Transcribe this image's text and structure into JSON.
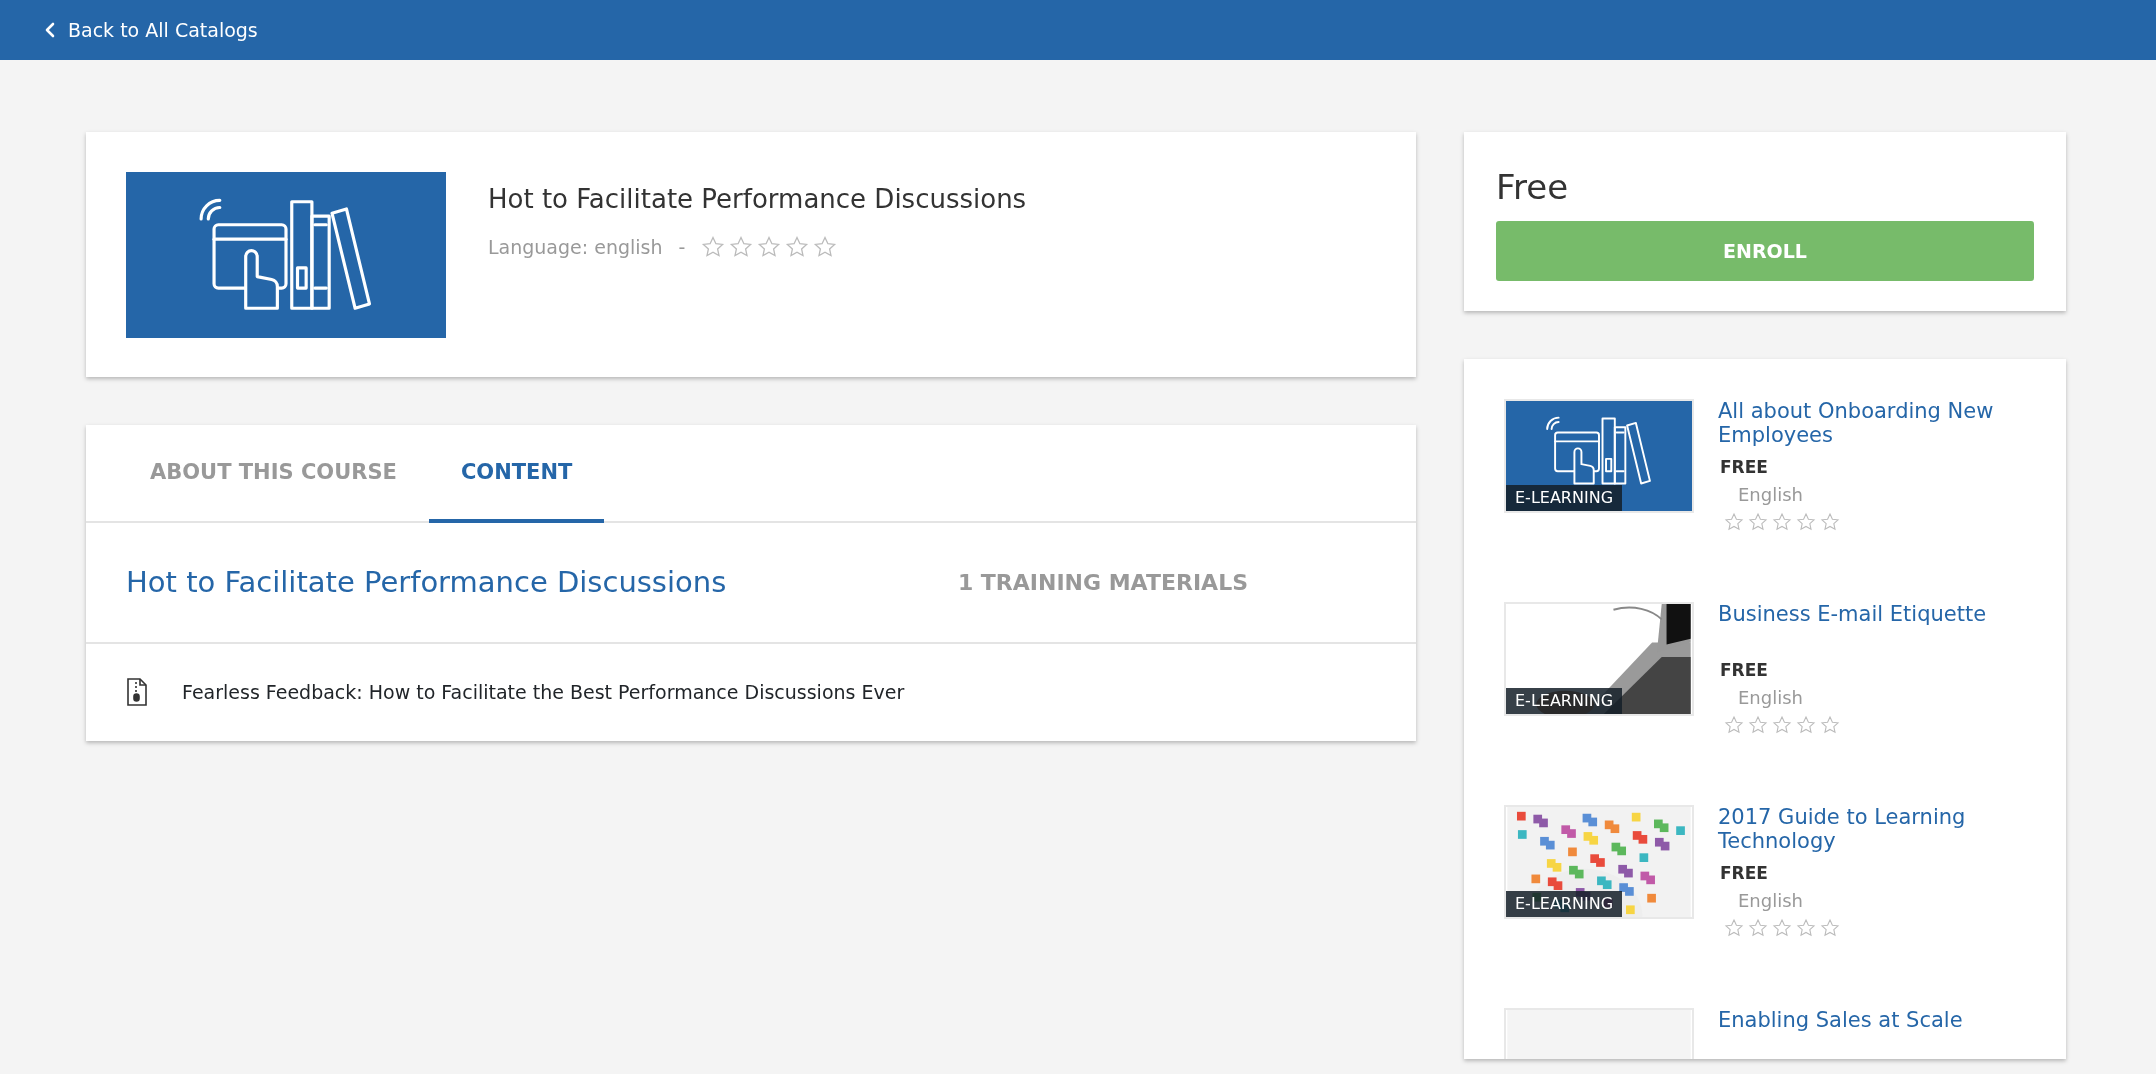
{
  "header": {
    "back_link": "Back to All Catalogs"
  },
  "course": {
    "title": "Hot to Facilitate Performance Discussions",
    "language": "Language: english",
    "separator": "-",
    "stars": 0
  },
  "purchase": {
    "price": "Free",
    "button": "ENROLL"
  },
  "tabs": [
    {
      "label": "ABOUT THIS COURSE",
      "selected": false
    },
    {
      "label": "CONTENT",
      "selected": true
    }
  ],
  "content": {
    "section_title": "Hot to Facilitate Performance Discussions",
    "count": "1 TRAINING MATERIALS",
    "materials": [
      {
        "title": "Fearless Feedback: How to Facilitate the Best Performance Discussions Ever"
      }
    ]
  },
  "related": [
    {
      "title": "All about Onboarding New Employees",
      "kind": "icon",
      "badge": "E-LEARNING",
      "price": "FREE",
      "language": "English",
      "stars": 0
    },
    {
      "title": "Business E-mail Etiquette",
      "kind": "laptop",
      "badge": "E-LEARNING",
      "price": "FREE",
      "language": "English",
      "stars": 0
    },
    {
      "title": "2017 Guide to Learning Technology",
      "kind": "puzzle",
      "badge": "E-LEARNING",
      "price": "FREE",
      "language": "English",
      "stars": 0
    },
    {
      "title": "Enabling Sales at Scale",
      "kind": "poster"
    }
  ]
}
